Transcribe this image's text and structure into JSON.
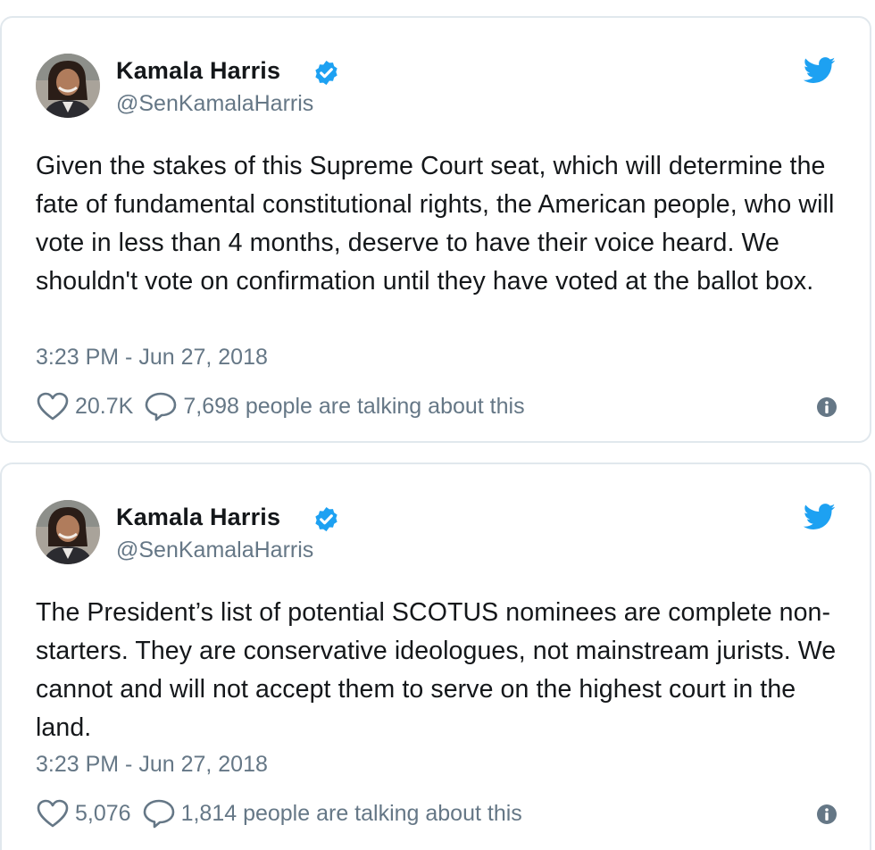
{
  "colors": {
    "text": "#14171a",
    "secondary_text": "#657786",
    "twitter_blue": "#1da1f2",
    "border": "#e1e8ed"
  },
  "tweets": [
    {
      "author_name": "Kamala Harris",
      "author_handle": "@SenKamalaHarris",
      "verified_icon": "verified-badge-icon",
      "brand_icon": "twitter-bird-icon",
      "text": "Given the stakes of this Supreme Court seat, which will determine the fate of fundamental constitutional rights, the American people, who will vote in less than 4 months, deserve to have their voice heard. We shouldn't vote on confirmation until they have voted at the ballot box.",
      "timestamp": "3:23 PM - Jun 27, 2018",
      "likes": "20.7K",
      "talking": "7,698 people are talking about this"
    },
    {
      "author_name": "Kamala Harris",
      "author_handle": "@SenKamalaHarris",
      "verified_icon": "verified-badge-icon",
      "brand_icon": "twitter-bird-icon",
      "text": "The President’s list of potential SCOTUS nominees are complete non-starters. They are conservative ideologues, not mainstream jurists. We cannot and will not accept them to serve on the highest court in the land.",
      "timestamp": "3:23 PM - Jun 27, 2018",
      "likes": "5,076",
      "talking": "1,814 people are talking about this"
    }
  ]
}
